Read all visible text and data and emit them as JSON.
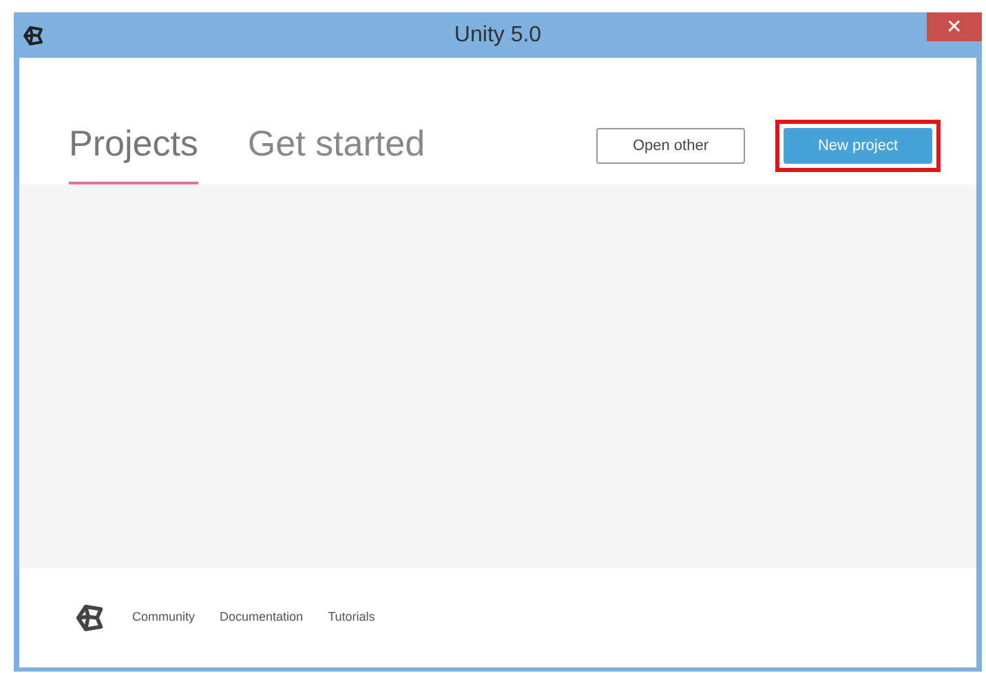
{
  "window": {
    "title": "Unity 5.0",
    "close": "✕"
  },
  "tabs": [
    {
      "label": "Projects",
      "selected": true
    },
    {
      "label": "Get started",
      "selected": false
    }
  ],
  "buttons": [
    {
      "label": "Open other",
      "kind": "secondary",
      "highlighted": false
    },
    {
      "label": "New project",
      "kind": "primary",
      "highlighted": true
    }
  ],
  "footer_links": [
    "Community",
    "Documentation",
    "Tutorials"
  ]
}
